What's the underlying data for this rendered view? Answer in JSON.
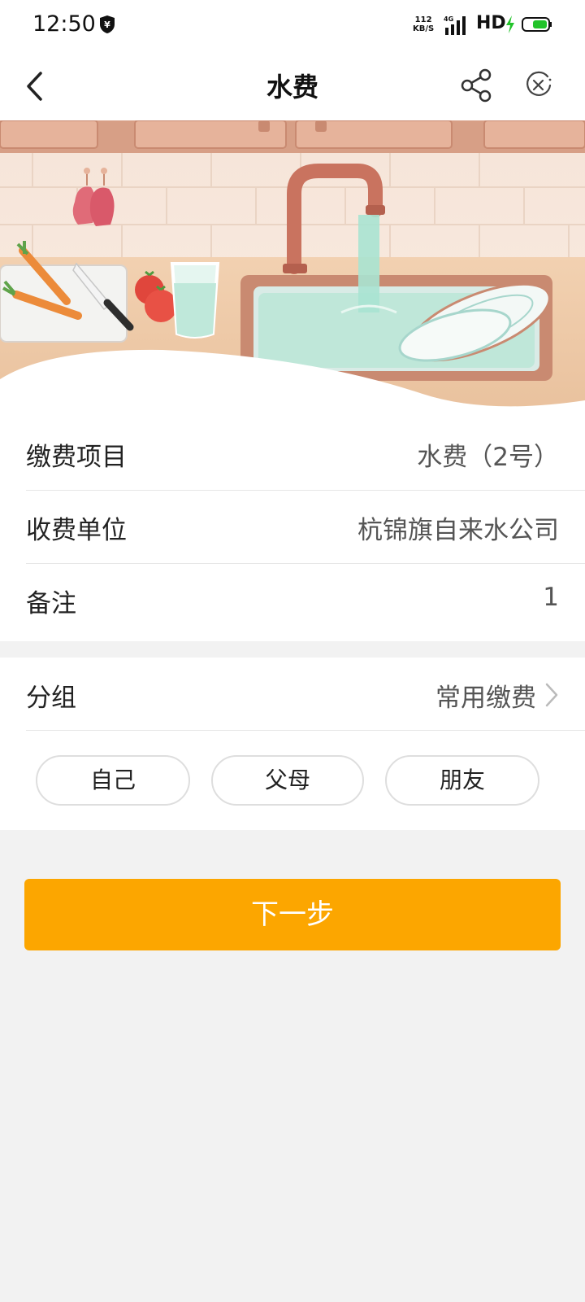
{
  "status_bar": {
    "time": "12:50",
    "net_speed_value": "112",
    "net_speed_unit": "KB/S",
    "network_type": "4G",
    "hd_label": "HD"
  },
  "nav": {
    "title": "水费"
  },
  "details": [
    {
      "label": "缴费项目",
      "value": "水费（2号）"
    },
    {
      "label": "收费单位",
      "value": "杭锦旗自来水公司"
    },
    {
      "label": "备注",
      "value": "1"
    }
  ],
  "group": {
    "label": "分组",
    "value": "常用缴费",
    "chips": [
      "自己",
      "父母",
      "朋友"
    ]
  },
  "next_button": "下一步",
  "colors": {
    "accent": "#fca600",
    "battery_green": "#22c32a"
  }
}
